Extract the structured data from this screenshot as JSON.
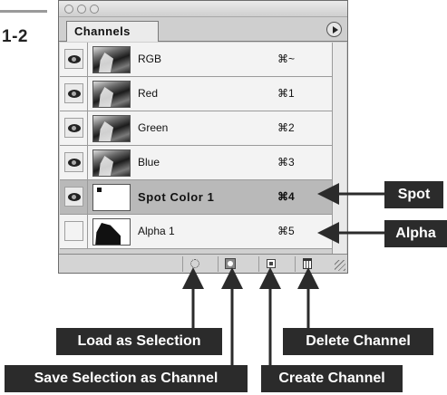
{
  "figure": {
    "number": "1-2"
  },
  "panel": {
    "tab_label": "Channels",
    "channels": [
      {
        "name": "RGB",
        "shortcut": "⌘~",
        "visible": true,
        "thumb": "photo",
        "selected": false
      },
      {
        "name": "Red",
        "shortcut": "⌘1",
        "visible": true,
        "thumb": "photo",
        "selected": false
      },
      {
        "name": "Green",
        "shortcut": "⌘2",
        "visible": true,
        "thumb": "photo",
        "selected": false
      },
      {
        "name": "Blue",
        "shortcut": "⌘3",
        "visible": true,
        "thumb": "photo",
        "selected": false
      },
      {
        "name": "Spot Color 1",
        "shortcut": "⌘4",
        "visible": true,
        "thumb": "spot",
        "selected": true
      },
      {
        "name": "Alpha 1",
        "shortcut": "⌘5",
        "visible": false,
        "thumb": "alpha",
        "selected": false
      }
    ],
    "bottom_buttons": [
      {
        "icon": "load-selection-icon"
      },
      {
        "icon": "save-selection-icon"
      },
      {
        "icon": "new-channel-icon"
      },
      {
        "icon": "trash-icon"
      }
    ]
  },
  "callouts": {
    "spot": "Spot",
    "alpha": "Alpha",
    "load_selection": "Load as Selection",
    "save_selection": "Save Selection as Channel",
    "create_channel": "Create Channel",
    "delete_channel": "Delete Channel"
  },
  "colors": {
    "callout_bg": "#2b2b2b",
    "selected_row": "#b9b9b9"
  }
}
